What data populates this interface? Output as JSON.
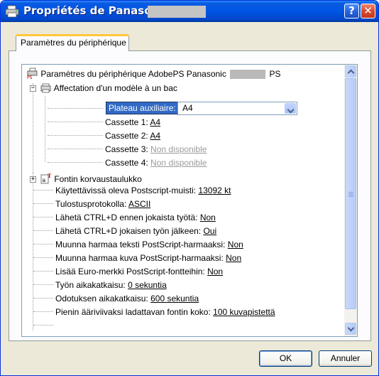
{
  "window": {
    "title": "Propriétés de Panasonic",
    "help_glyph": "?",
    "close_glyph": "✕"
  },
  "tab": {
    "label": "Paramètres du périphérique"
  },
  "tree": {
    "root_label_a": "Paramètres du périphérique AdobePS Panasonic",
    "root_label_b": "PS",
    "mapping_group_label": "Affectation d'un modèle à un bac",
    "tray_aux": {
      "label": "Plateau auxiliaire:",
      "value": "A4"
    },
    "cassettes": [
      {
        "label": "Cassette 1:",
        "value": "A4"
      },
      {
        "label": "Cassette 2:",
        "value": "A4"
      },
      {
        "label": "Cassette 3:",
        "value": "Non disponible"
      },
      {
        "label": "Cassette 4:",
        "value": "Non disponible"
      }
    ],
    "font_table_label": "Fontin korvaustaulukko",
    "settings": [
      {
        "label": "Käytettävissä oleva Postscript-muisti:",
        "value": "13092 kt"
      },
      {
        "label": "Tulostusprotokolla:",
        "value": "ASCII"
      },
      {
        "label": "Lähetä CTRL+D ennen jokaista työtä:",
        "value": "Non"
      },
      {
        "label": "Lähetä CTRL+D jokaisen työn jälkeen:",
        "value": "Oui"
      },
      {
        "label": "Muunna harmaa teksti PostScript-harmaaksi:",
        "value": "Non"
      },
      {
        "label": "Muunna harmaa kuva PostScript-harmaaksi:",
        "value": "Non"
      },
      {
        "label": "Lisää Euro-merkki PostScript-fontteihin:",
        "value": "Non"
      },
      {
        "label": "Työn aikakatkaisu:",
        "value": "0 sekuntia"
      },
      {
        "label": "Odotuksen aikakatkaisu:",
        "value": "600 sekuntia"
      },
      {
        "label": "Pienin ääriviivaksi ladattavan fontin koko:",
        "value": "100 kuvapistettä"
      }
    ]
  },
  "buttons": {
    "ok": "OK",
    "cancel": "Annuler"
  },
  "colors": {
    "titlebar": "#0055e5",
    "selection": "#316ac5",
    "window_bg": "#ece9d8",
    "disabled_text": "#9b9b9b"
  }
}
